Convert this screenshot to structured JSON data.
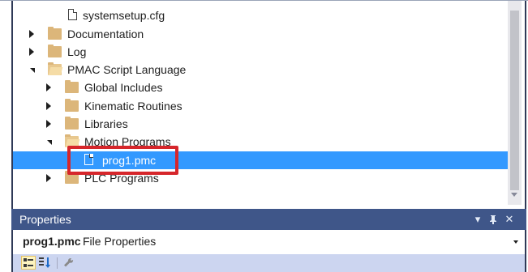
{
  "tree": {
    "items": [
      {
        "label": "systemsetup.cfg",
        "type": "file"
      },
      {
        "label": "Documentation",
        "type": "folder",
        "state": "collapsed"
      },
      {
        "label": "Log",
        "type": "folder",
        "state": "collapsed"
      },
      {
        "label": "PMAC Script Language",
        "type": "folder",
        "state": "expanded"
      },
      {
        "label": "Global Includes",
        "type": "folder",
        "state": "collapsed"
      },
      {
        "label": "Kinematic Routines",
        "type": "folder",
        "state": "collapsed"
      },
      {
        "label": "Libraries",
        "type": "folder",
        "state": "collapsed"
      },
      {
        "label": "Motion Programs",
        "type": "folder",
        "state": "expanded"
      },
      {
        "label": "prog1.pmc",
        "type": "file",
        "selected": true
      },
      {
        "label": "PLC Programs",
        "type": "folder",
        "state": "collapsed"
      }
    ]
  },
  "properties": {
    "title": "Properties",
    "header_buttons": [
      "▾",
      "ᵖ",
      "✕"
    ],
    "object_name": "prog1.pmc",
    "object_kind": "File Properties"
  },
  "colors": {
    "selection": "#3399ff",
    "highlight_box": "#d6262b",
    "panel_header": "#3f5689",
    "toolbar": "#ccd5f0"
  }
}
